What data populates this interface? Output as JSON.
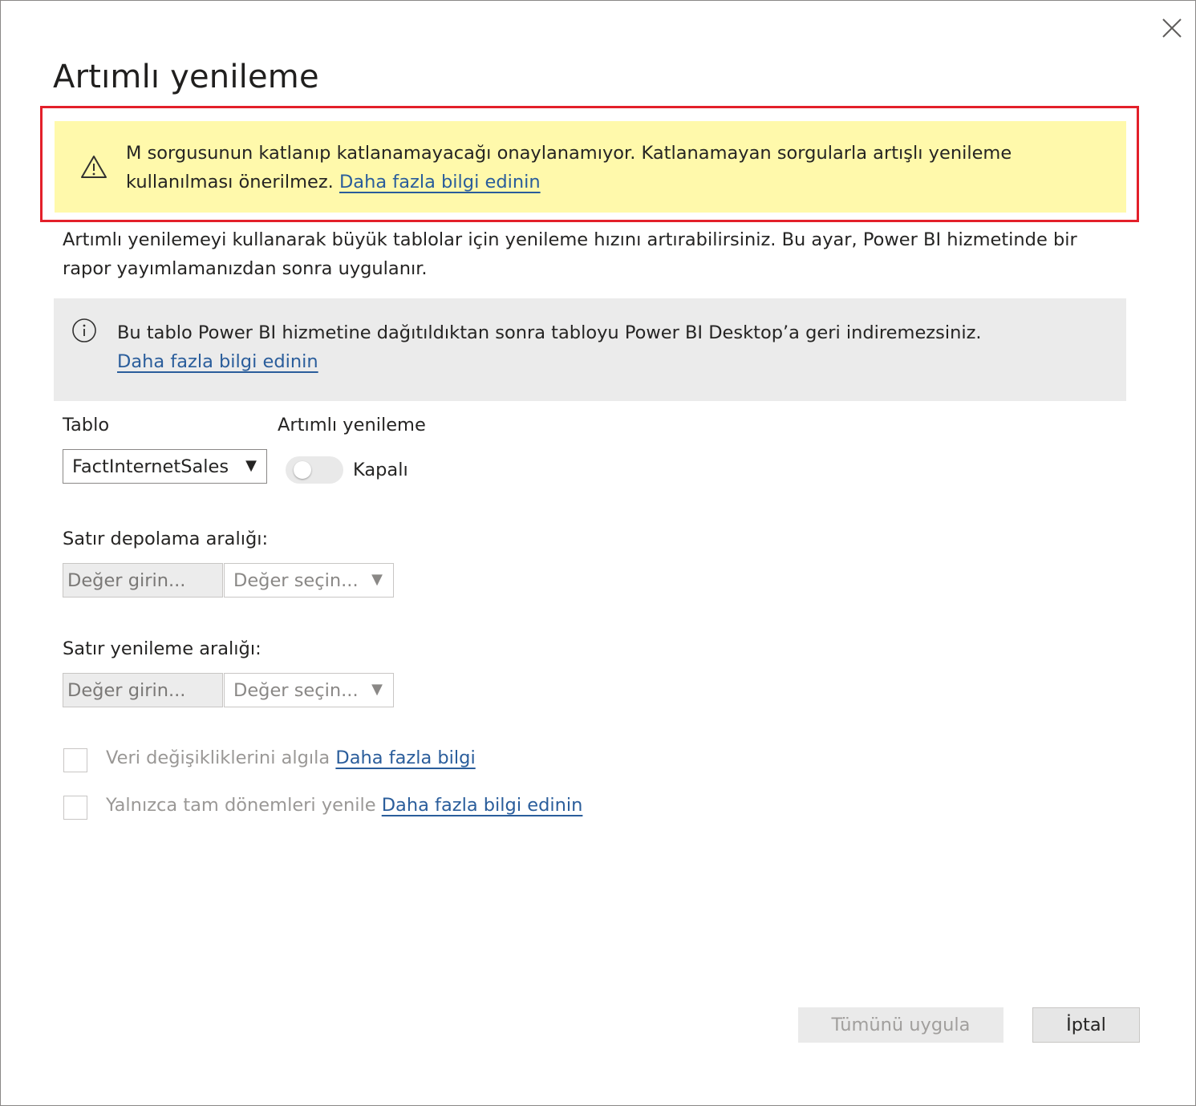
{
  "dialog": {
    "title": "Artımlı yenileme",
    "close_icon": "close-icon"
  },
  "warning": {
    "icon": "warning-icon",
    "text": "M sorgusunun katlanıp katlanamayacağı onaylanamıyor. Katlanamayan sorgularla artışlı yenileme kullanılması önerilmez.",
    "link": "Daha fazla bilgi edinin",
    "highlight_color": "#e3202a",
    "background": "#fff9ab"
  },
  "description": "Artımlı yenilemeyi kullanarak büyük tablolar için yenileme hızını artırabilirsiniz. Bu ayar, Power BI hizmetinde bir rapor yayımlamanızdan sonra uygulanır.",
  "info": {
    "icon": "info-icon",
    "text": "Bu tablo Power BI hizmetine dağıtıldıktan sonra tabloyu Power BI Desktop’a geri indiremezsiniz.",
    "link": "Daha fazla bilgi edinin"
  },
  "table": {
    "label": "Tablo",
    "selected": "FactInternetSales",
    "arrow": "▼"
  },
  "incremental": {
    "label": "Artımlı yenileme",
    "toggle_state": "Kapalı",
    "toggle_on": false
  },
  "storage": {
    "label": "Satır depolama aralığı:",
    "input_placeholder": "Değer girin...",
    "select_placeholder": "Değer seçin...",
    "arrow": "▼"
  },
  "refresh": {
    "label": "Satır yenileme aralığı:",
    "input_placeholder": "Değer girin...",
    "select_placeholder": "Değer seçin...",
    "arrow": "▼"
  },
  "options": {
    "detect_changes": {
      "label": "Veri değişikliklerini algıla",
      "link": "Daha fazla bilgi",
      "checked": false
    },
    "complete_periods": {
      "label": "Yalnızca tam dönemleri yenile",
      "link": "Daha fazla bilgi edinin",
      "checked": false
    }
  },
  "buttons": {
    "apply": "Tümünü uygula",
    "cancel": "İptal"
  },
  "link_color": "#2a5d9b"
}
